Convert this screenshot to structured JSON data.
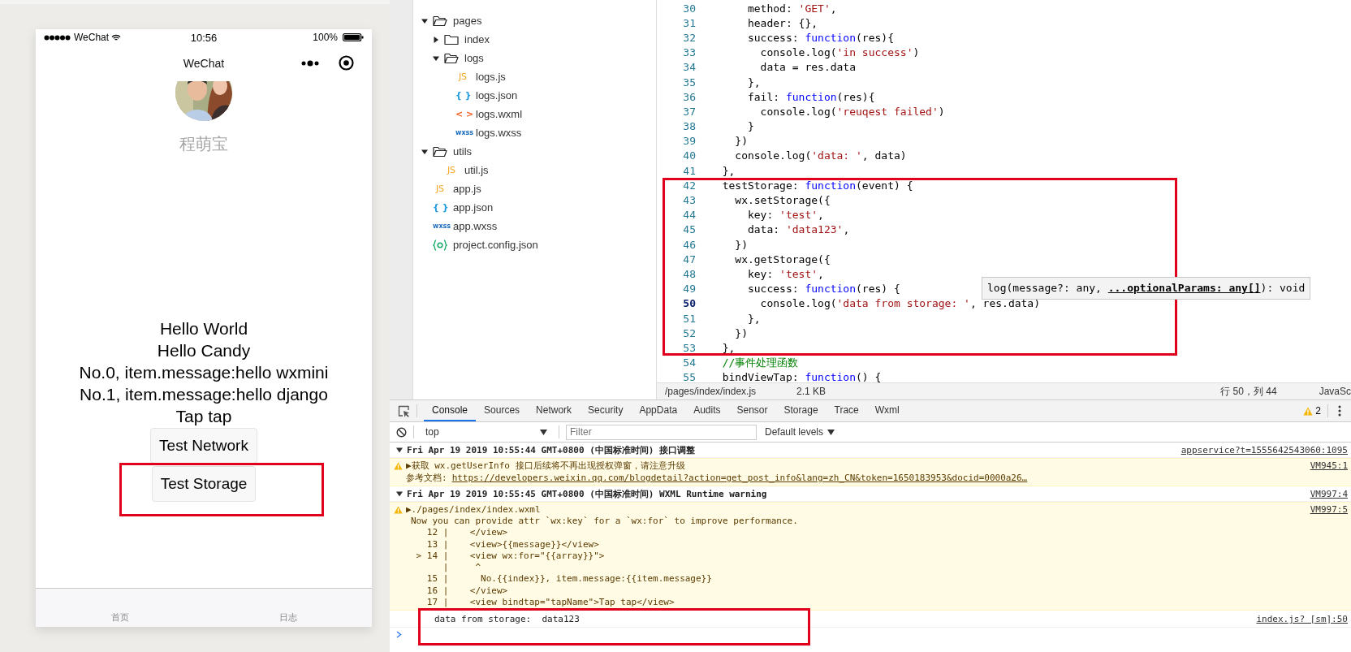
{
  "phone": {
    "status_bar": {
      "carrier": "WeChat",
      "time": "10:56",
      "battery": "100%"
    },
    "nav": {
      "title": "WeChat"
    },
    "avatar": {
      "kind": "picture"
    },
    "user_name": "程萌宝",
    "lines": [
      "Hello World",
      "Hello Candy",
      "No.0, item.message:hello wxmini",
      "No.1, item.message:hello django",
      "Tap tap"
    ],
    "buttons": [
      {
        "label": "Test Network",
        "highlight": false
      },
      {
        "label": "Test Storage",
        "highlight": true
      }
    ],
    "tab_bar": [
      {
        "label": "首页"
      },
      {
        "label": "日志"
      }
    ]
  },
  "file_tree": [
    {
      "name": "pages",
      "kind": "folder",
      "expanded": true,
      "children": [
        {
          "name": "index",
          "kind": "folder",
          "expanded": false
        },
        {
          "name": "logs",
          "kind": "folder",
          "expanded": true,
          "children": [
            {
              "name": "logs.js",
              "kind": "js",
              "icon": "JS"
            },
            {
              "name": "logs.json",
              "kind": "json",
              "icon": "{ }"
            },
            {
              "name": "logs.wxml",
              "kind": "wxml",
              "icon": "< >"
            },
            {
              "name": "logs.wxss",
              "kind": "wxss",
              "icon": "wxss"
            }
          ]
        }
      ]
    },
    {
      "name": "utils",
      "kind": "folder",
      "expanded": true,
      "children": [
        {
          "name": "util.js",
          "kind": "js",
          "icon": "JS"
        }
      ]
    },
    {
      "name": "app.js",
      "kind": "js",
      "icon": "JS"
    },
    {
      "name": "app.json",
      "kind": "json",
      "icon": "{ }"
    },
    {
      "name": "app.wxss",
      "kind": "wxss",
      "icon": "wxss"
    },
    {
      "name": "project.config.json",
      "kind": "config"
    }
  ],
  "editor": {
    "blocks": [
      {
        "highlight": false,
        "lines": [
          {
            "no": "30",
            "tokens": [
              {
                "kind": "plain",
                "text": "      method: "
              },
              {
                "kind": "string",
                "text": "'GET'"
              },
              {
                "kind": "plain",
                "text": ","
              }
            ]
          },
          {
            "no": "31",
            "tokens": [
              {
                "kind": "plain",
                "text": "      header: {},"
              }
            ]
          },
          {
            "no": "32",
            "tokens": [
              {
                "kind": "plain",
                "text": "      success: "
              },
              {
                "kind": "keyword",
                "text": "function"
              },
              {
                "kind": "plain",
                "text": "(res){"
              }
            ]
          },
          {
            "no": "33",
            "tokens": [
              {
                "kind": "plain",
                "text": "        console.log("
              },
              {
                "kind": "string",
                "text": "'in success'"
              },
              {
                "kind": "plain",
                "text": ")"
              }
            ]
          },
          {
            "no": "34",
            "tokens": [
              {
                "kind": "plain",
                "text": "        data = res.data"
              }
            ]
          },
          {
            "no": "35",
            "tokens": [
              {
                "kind": "plain",
                "text": "      },"
              }
            ]
          },
          {
            "no": "36",
            "tokens": [
              {
                "kind": "plain",
                "text": "      fail: "
              },
              {
                "kind": "keyword",
                "text": "function"
              },
              {
                "kind": "plain",
                "text": "(res){"
              }
            ]
          },
          {
            "no": "37",
            "tokens": [
              {
                "kind": "plain",
                "text": "        console.log("
              },
              {
                "kind": "string",
                "text": "'reuqest failed'"
              },
              {
                "kind": "plain",
                "text": ")"
              }
            ]
          },
          {
            "no": "38",
            "tokens": [
              {
                "kind": "plain",
                "text": "      }"
              }
            ]
          },
          {
            "no": "39",
            "tokens": [
              {
                "kind": "plain",
                "text": "    })"
              }
            ]
          },
          {
            "no": "40",
            "tokens": [
              {
                "kind": "plain",
                "text": "    console.log("
              },
              {
                "kind": "string",
                "text": "'data: '"
              },
              {
                "kind": "plain",
                "text": ", data)"
              }
            ]
          },
          {
            "no": "41",
            "tokens": [
              {
                "kind": "plain",
                "text": "  },"
              }
            ]
          }
        ]
      },
      {
        "highlight": true,
        "lines": [
          {
            "no": "42",
            "tokens": [
              {
                "kind": "plain",
                "text": "  testStorage: "
              },
              {
                "kind": "keyword",
                "text": "function"
              },
              {
                "kind": "plain",
                "text": "(event) {"
              }
            ]
          },
          {
            "no": "43",
            "tokens": [
              {
                "kind": "plain",
                "text": "    wx.setStorage({"
              }
            ]
          },
          {
            "no": "44",
            "tokens": [
              {
                "kind": "plain",
                "text": "      key: "
              },
              {
                "kind": "string",
                "text": "'test'"
              },
              {
                "kind": "plain",
                "text": ","
              }
            ]
          },
          {
            "no": "45",
            "tokens": [
              {
                "kind": "plain",
                "text": "      data: "
              },
              {
                "kind": "string",
                "text": "'data123'"
              },
              {
                "kind": "plain",
                "text": ","
              }
            ]
          },
          {
            "no": "46",
            "tokens": [
              {
                "kind": "plain",
                "text": "    })"
              }
            ]
          },
          {
            "no": "47",
            "tokens": [
              {
                "kind": "plain",
                "text": "    wx.getStorage({"
              }
            ]
          },
          {
            "no": "48",
            "tokens": [
              {
                "kind": "plain",
                "text": "      key: "
              },
              {
                "kind": "string",
                "text": "'test'"
              },
              {
                "kind": "plain",
                "text": ","
              }
            ]
          },
          {
            "no": "49",
            "tokens": [
              {
                "kind": "plain",
                "text": "      success: "
              },
              {
                "kind": "keyword",
                "text": "function"
              },
              {
                "kind": "plain",
                "text": "(res) {"
              }
            ]
          },
          {
            "no": "50",
            "current": true,
            "tokens": [
              {
                "kind": "plain",
                "text": "        console.log("
              },
              {
                "kind": "string",
                "text": "'data from storage: '"
              },
              {
                "kind": "plain",
                "text": ", res.data)"
              }
            ]
          },
          {
            "no": "51",
            "tokens": [
              {
                "kind": "plain",
                "text": "      },"
              }
            ]
          },
          {
            "no": "52",
            "tokens": [
              {
                "kind": "plain",
                "text": "    })"
              }
            ]
          },
          {
            "no": "53",
            "tokens": [
              {
                "kind": "plain",
                "text": "  },"
              }
            ]
          }
        ]
      },
      {
        "highlight": false,
        "lines": [
          {
            "no": "54",
            "tokens": [
              {
                "kind": "comment",
                "text": "  //事件处理函数"
              }
            ]
          },
          {
            "no": "55",
            "tokens": [
              {
                "kind": "plain",
                "text": "  bindViewTap: "
              },
              {
                "kind": "keyword",
                "text": "function"
              },
              {
                "kind": "plain",
                "text": "() {"
              }
            ]
          }
        ]
      }
    ],
    "tooltip": "log(message?: any, **...optionalParams: any[]**): void",
    "status": {
      "path": "/pages/index/index.js",
      "size": "2.1 KB",
      "cursor": "行 50，列 44",
      "language": "JavaSc"
    }
  },
  "devtools": {
    "tabs": [
      {
        "label": "Console",
        "selected": true
      },
      {
        "label": "Sources",
        "selected": false
      },
      {
        "label": "Network",
        "selected": false
      },
      {
        "label": "Security",
        "selected": false
      },
      {
        "label": "AppData",
        "selected": false
      },
      {
        "label": "Audits",
        "selected": false
      },
      {
        "label": "Sensor",
        "selected": false
      },
      {
        "label": "Storage",
        "selected": false
      },
      {
        "label": "Trace",
        "selected": false
      },
      {
        "label": "Wxml",
        "selected": false
      }
    ],
    "warning_count": "2",
    "context": "top",
    "filter_placeholder": "Filter",
    "levels": "Default levels",
    "messages": [
      {
        "kind": "group",
        "expanded": true,
        "text": "Fri Apr 19 2019 10:55:44 GMT+0800 (中国标准时间) 接口调整",
        "source": "appservice?t=1555642543060:1095"
      },
      {
        "kind": "warning",
        "title": "▶获取 wx.getUserInfo 接口后续将不再出现授权弹窗，请注意升级",
        "source": "VM945:1",
        "ref_label": "参考文档:",
        "ref_link": "https://developers.weixin.qq.com/blogdetail?action=get_post_info&lang=zh_CN&token=1650183953&docid=0000a26…"
      },
      {
        "kind": "group",
        "expanded": true,
        "text": "Fri Apr 19 2019 10:55:45 GMT+0800 (中国标准时间) WXML Runtime warning",
        "source": "VM997:4"
      },
      {
        "kind": "warning",
        "title": "▶./pages/index/index.wxml",
        "source": "VM997:5",
        "details": [
          "Now you can provide attr `wx:key` for a `wx:for` to improve performance.",
          "   12 |    </view>",
          "   13 |    <view>{{message}}</view>",
          " > 14 |    <view wx:for=\"{{array}}\">",
          "      |     ^",
          "   15 |      No.{{index}}, item.message:{{item.message}}",
          "   16 |    </view>",
          "   17 |    <view bindtap=\"tapName\">Tap tap</view>"
        ]
      },
      {
        "kind": "log",
        "highlight": true,
        "text": "data from storage:  data123",
        "source": "index.js? [sm]:50"
      }
    ]
  }
}
